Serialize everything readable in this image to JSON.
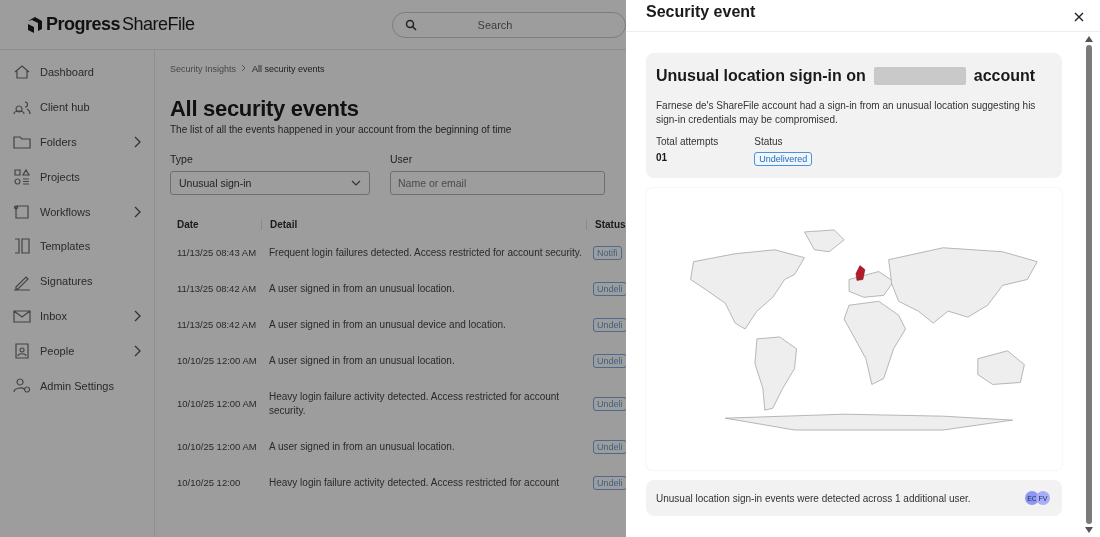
{
  "brand": {
    "name": "Progress",
    "product": "ShareFile"
  },
  "search": {
    "placeholder": "Search"
  },
  "sidebar": {
    "items": [
      {
        "label": "Dashboard",
        "expandable": false
      },
      {
        "label": "Client hub",
        "expandable": false
      },
      {
        "label": "Folders",
        "expandable": true
      },
      {
        "label": "Projects",
        "expandable": false
      },
      {
        "label": "Workflows",
        "expandable": true
      },
      {
        "label": "Templates",
        "expandable": false
      },
      {
        "label": "Signatures",
        "expandable": false
      },
      {
        "label": "Inbox",
        "expandable": true
      },
      {
        "label": "People",
        "expandable": true
      },
      {
        "label": "Admin Settings",
        "expandable": false
      }
    ]
  },
  "breadcrumb": [
    "Security Insights",
    "All security events"
  ],
  "page": {
    "title": "All security events",
    "subtitle": "The list of all the events happened in your account from the beginning of time"
  },
  "filters": {
    "type": {
      "label": "Type",
      "value": "Unusual sign-in"
    },
    "user": {
      "label": "User",
      "placeholder": "Name or email"
    }
  },
  "table": {
    "columns": [
      "Date",
      "Detail",
      "Status"
    ],
    "rows": [
      {
        "date": "11/13/25 08:43 AM",
        "detail": "Frequent login failures detected. Access restricted for account security.",
        "status": "Notifi"
      },
      {
        "date": "11/13/25 08:42 AM",
        "detail": "A user signed in from an unusual location.",
        "status": "Undeli"
      },
      {
        "date": "11/13/25 08:42 AM",
        "detail": "A user signed in from an unusual device and location.",
        "status": "Undeli"
      },
      {
        "date": "10/10/25 12:00 AM",
        "detail": "A user signed in from an unusual location.",
        "status": "Undeli"
      },
      {
        "date": "10/10/25 12:00 AM",
        "detail": "Heavy login failure activity detected. Access restricted for account security.",
        "status": "Undeli"
      },
      {
        "date": "10/10/25 12:00 AM",
        "detail": "A user signed in from an unusual location.",
        "status": "Undeli"
      },
      {
        "date": "10/10/25 12:00",
        "detail": "Heavy login failure activity detected. Access restricted for account",
        "status": "Undeli"
      }
    ]
  },
  "drawer": {
    "title": "Security event",
    "heading_start": "Unusual location sign-in on",
    "heading_end": "account",
    "description": "Farnese de's ShareFile account had a sign-in from an unusual location suggesting his sign-in credentials may be compromised.",
    "attempts": {
      "label": "Total attempts",
      "value": "01"
    },
    "status": {
      "label": "Status",
      "value": "Undelivered"
    },
    "footer": {
      "text": "Unusual location sign-in events were detected across 1 additional user.",
      "avatars": [
        {
          "initials": "EC",
          "color": "#8f98f0"
        },
        {
          "initials": "FV",
          "color": "#a6aef7"
        }
      ]
    }
  }
}
